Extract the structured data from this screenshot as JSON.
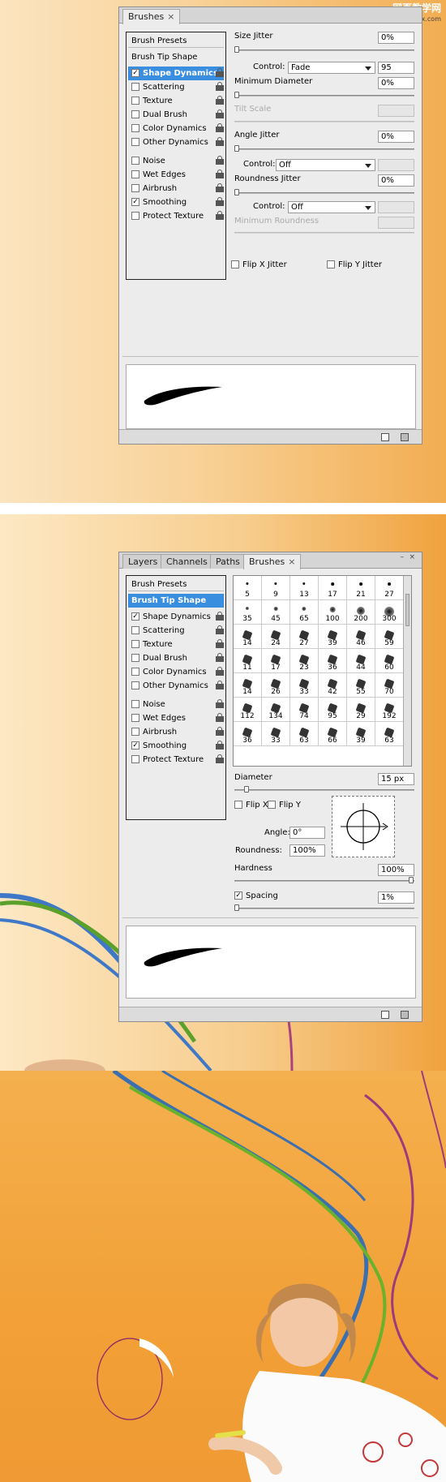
{
  "watermark": {
    "cn": "网页教学网",
    "url": "www.webjx.com"
  },
  "panel1": {
    "tab": "Brushes",
    "left": {
      "brush_presets": "Brush Presets",
      "brush_tip_shape": "Brush Tip Shape",
      "items": [
        {
          "label": "Shape Dynamics",
          "checked": true,
          "selected": true
        },
        {
          "label": "Scattering",
          "checked": false
        },
        {
          "label": "Texture",
          "checked": false
        },
        {
          "label": "Dual Brush",
          "checked": false
        },
        {
          "label": "Color Dynamics",
          "checked": false
        },
        {
          "label": "Other Dynamics",
          "checked": false
        },
        {
          "label": "Noise",
          "checked": false
        },
        {
          "label": "Wet Edges",
          "checked": false
        },
        {
          "label": "Airbrush",
          "checked": false
        },
        {
          "label": "Smoothing",
          "checked": true
        },
        {
          "label": "Protect Texture",
          "checked": false
        }
      ]
    },
    "right": {
      "size_jitter_label": "Size Jitter",
      "size_jitter_value": "0%",
      "control_label": "Control:",
      "control1_value": "Fade",
      "control1_number": "95",
      "min_diameter_label": "Minimum Diameter",
      "min_diameter_value": "0%",
      "tilt_scale_label": "Tilt Scale",
      "angle_jitter_label": "Angle Jitter",
      "angle_jitter_value": "0%",
      "control2_value": "Off",
      "roundness_jitter_label": "Roundness Jitter",
      "roundness_jitter_value": "0%",
      "control3_value": "Off",
      "min_roundness_label": "Minimum Roundness",
      "flip_x_label": "Flip X Jitter",
      "flip_y_label": "Flip Y Jitter"
    }
  },
  "panel2": {
    "tabs": [
      "Layers",
      "Channels",
      "Paths",
      "Brushes"
    ],
    "left": {
      "brush_presets": "Brush Presets",
      "brush_tip_shape": "Brush Tip Shape",
      "items": [
        {
          "label": "Shape Dynamics",
          "checked": true
        },
        {
          "label": "Scattering",
          "checked": false
        },
        {
          "label": "Texture",
          "checked": false
        },
        {
          "label": "Dual Brush",
          "checked": false
        },
        {
          "label": "Color Dynamics",
          "checked": false
        },
        {
          "label": "Other Dynamics",
          "checked": false
        },
        {
          "label": "Noise",
          "checked": false
        },
        {
          "label": "Wet Edges",
          "checked": false
        },
        {
          "label": "Airbrush",
          "checked": false
        },
        {
          "label": "Smoothing",
          "checked": true
        },
        {
          "label": "Protect Texture",
          "checked": false
        }
      ]
    },
    "brush_sizes": [
      "5",
      "9",
      "13",
      "17",
      "21",
      "27",
      "35",
      "45",
      "65",
      "100",
      "200",
      "300",
      "14",
      "24",
      "27",
      "39",
      "46",
      "59",
      "11",
      "17",
      "23",
      "36",
      "44",
      "60",
      "14",
      "26",
      "33",
      "42",
      "55",
      "70",
      "112",
      "134",
      "74",
      "95",
      "29",
      "192",
      "36",
      "33",
      "63",
      "66",
      "39",
      "63"
    ],
    "diameter_label": "Diameter",
    "diameter_value": "15 px",
    "flip_x": "Flip X",
    "flip_y": "Flip Y",
    "angle_label": "Angle:",
    "angle_value": "0°",
    "roundness_label": "Roundness:",
    "roundness_value": "100%",
    "hardness_label": "Hardness",
    "hardness_value": "100%",
    "spacing_label": "Spacing",
    "spacing_value": "1%",
    "spacing_checked": true
  }
}
